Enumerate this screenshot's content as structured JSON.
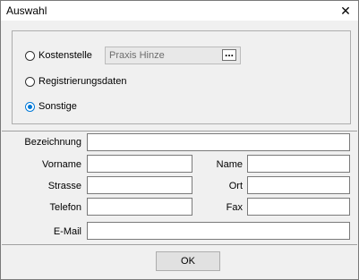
{
  "window": {
    "title": "Auswahl",
    "close_glyph": "✕"
  },
  "options": [
    {
      "label": "Kostenstelle",
      "checked": false
    },
    {
      "label": "Registrierungsdaten",
      "checked": false
    },
    {
      "label": "Sonstige",
      "checked": true
    }
  ],
  "kostenstelle_combo": {
    "value": "Praxis Hinze",
    "button_label": "..."
  },
  "fields": {
    "bezeichnung": {
      "label": "Bezeichnung",
      "value": ""
    },
    "vorname": {
      "label": "Vorname",
      "value": ""
    },
    "name": {
      "label": "Name",
      "value": ""
    },
    "strasse": {
      "label": "Strasse",
      "value": ""
    },
    "ort": {
      "label": "Ort",
      "value": ""
    },
    "telefon": {
      "label": "Telefon",
      "value": ""
    },
    "fax": {
      "label": "Fax",
      "value": ""
    },
    "email": {
      "label": "E-Mail",
      "value": ""
    }
  },
  "ok_button": {
    "label": "OK"
  },
  "colors": {
    "accent": "#0078d7",
    "panel_bg": "#f0f0f0"
  }
}
